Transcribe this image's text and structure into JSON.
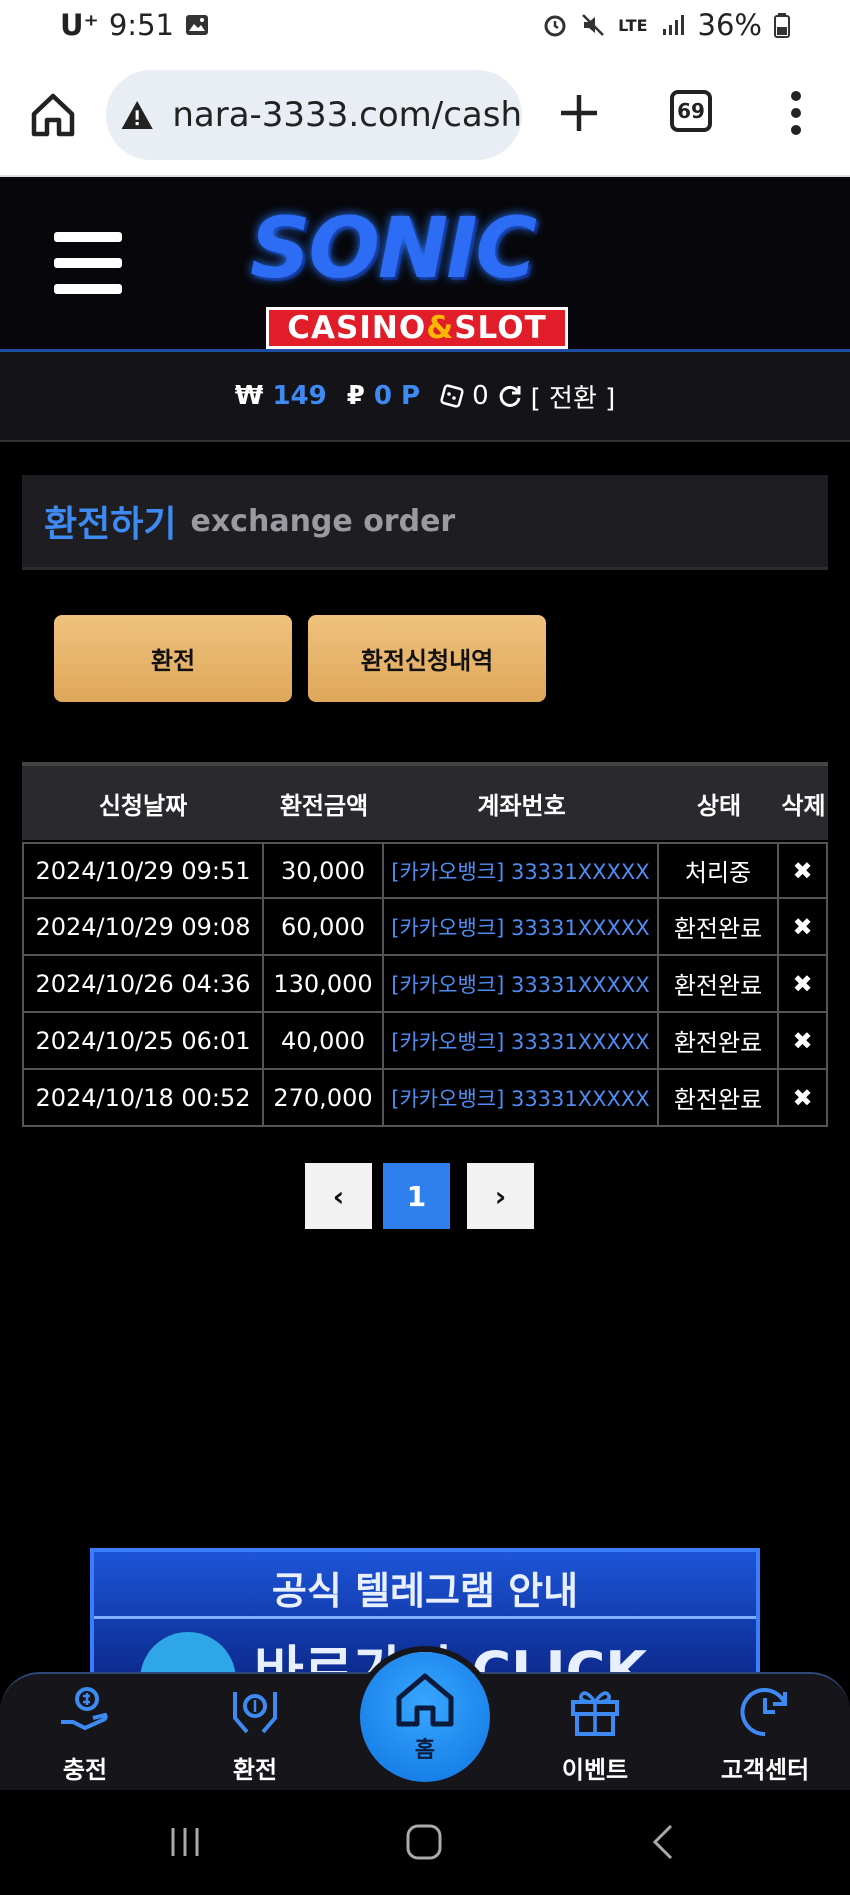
{
  "status_bar": {
    "carrier": "U⁺",
    "time": "9:51",
    "network": "LTE",
    "battery": "36%"
  },
  "browser": {
    "url": "nara-3333.com/cash",
    "tab_count": "69"
  },
  "site": {
    "logo_title": "SONIC",
    "logo_subtitle_1": "CASINO",
    "logo_amp": "&",
    "logo_subtitle_2": "SLOT"
  },
  "balance": {
    "won_symbol": "₩",
    "won_value": "149",
    "point_symbol": "₽",
    "point_value": "0 P",
    "chip_value": "0",
    "convert_label": "[ 전환 ]"
  },
  "section": {
    "title_ko": "환전하기",
    "title_en": "exchange order"
  },
  "buttons": {
    "exchange": "환전",
    "history": "환전신청내역"
  },
  "table": {
    "headers": [
      "신청날짜",
      "환전금액",
      "계좌번호",
      "상태",
      "삭제"
    ],
    "rows": [
      {
        "date": "2024/10/29 09:51",
        "amount": "30,000",
        "account": "[카카오뱅크] 33331XXXXX",
        "status": "처리중",
        "delete": "✖"
      },
      {
        "date": "2024/10/29 09:08",
        "amount": "60,000",
        "account": "[카카오뱅크] 33331XXXXX",
        "status": "환전완료",
        "delete": "✖"
      },
      {
        "date": "2024/10/26 04:36",
        "amount": "130,000",
        "account": "[카카오뱅크] 33331XXXXX",
        "status": "환전완료",
        "delete": "✖"
      },
      {
        "date": "2024/10/25 06:01",
        "amount": "40,000",
        "account": "[카카오뱅크] 33331XXXXX",
        "status": "환전완료",
        "delete": "✖"
      },
      {
        "date": "2024/10/18 00:52",
        "amount": "270,000",
        "account": "[카카오뱅크] 33331XXXXX",
        "status": "환전완료",
        "delete": "✖"
      }
    ]
  },
  "pagination": {
    "prev": "‹",
    "current": "1",
    "next": "›"
  },
  "banner": {
    "title": "공식 텔레그램 안내",
    "subtitle": "바로가기 CLICK"
  },
  "bottom_nav": {
    "charge": "충전",
    "exchange": "환전",
    "home": "홈",
    "event": "이벤트",
    "support": "고객센터"
  },
  "colors": {
    "accent_blue": "#3d8bf2",
    "gold": "#e8b56a",
    "background": "#000000"
  }
}
